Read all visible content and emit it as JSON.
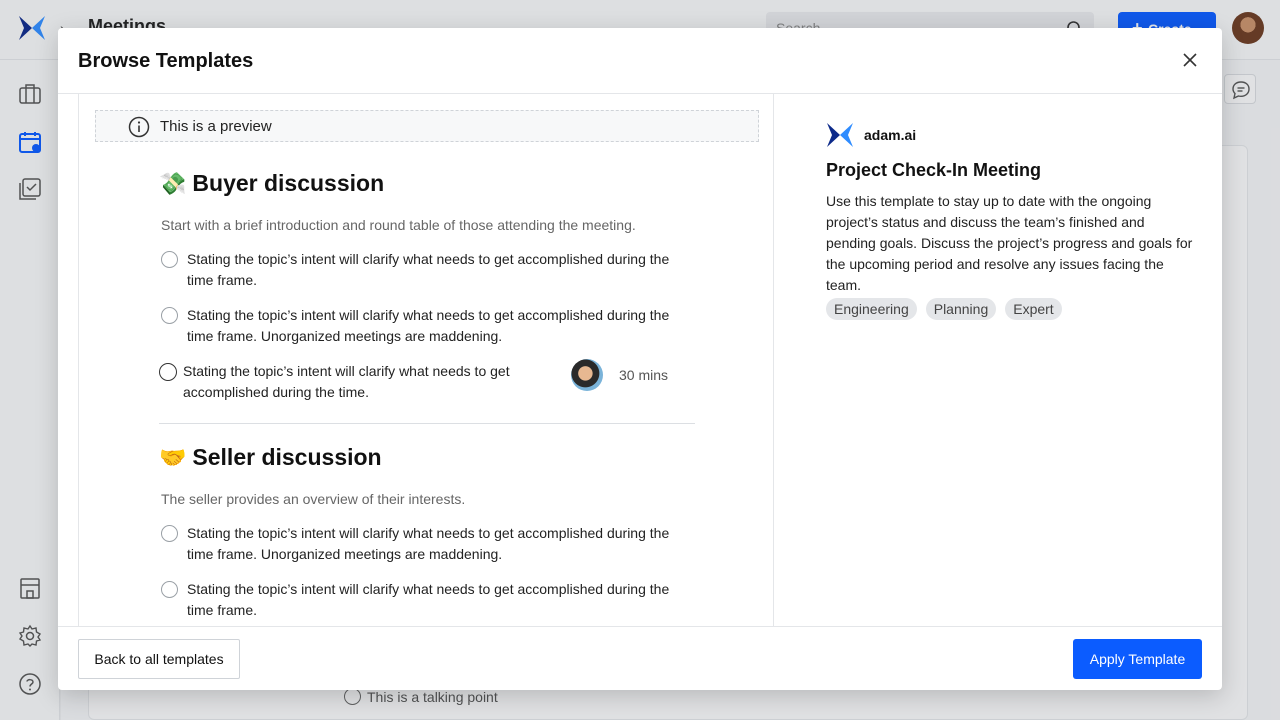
{
  "app": {
    "title": "Meetings",
    "search_placeholder": "Search",
    "create_label": "Create",
    "background_talking_point": "This is a talking point"
  },
  "modal": {
    "title": "Browse Templates",
    "preview_banner": "This is a preview",
    "sections": [
      {
        "emoji": "💸",
        "title": "Buyer discussion",
        "description": "Start with a brief introduction and round table of those attending the meeting.",
        "points": [
          "Stating the topic’s intent will clarify what needs to get accomplished during the time frame.",
          "Stating the topic’s intent will clarify what needs to get accomplished during the time frame. Unorganized meetings are maddening.",
          "Stating the topic’s intent will clarify what needs to get accomplished during the time."
        ],
        "point_duration": "30 mins"
      },
      {
        "emoji": "🤝",
        "title": "Seller discussion",
        "description": "The seller provides an overview of their interests.",
        "points": [
          "Stating the topic’s intent will clarify what needs to get accomplished during the time frame. Unorganized meetings are maddening.",
          "Stating the topic’s intent will clarify what needs to get accomplished during the time frame."
        ]
      }
    ],
    "info": {
      "brand": "adam.ai",
      "template_title": "Project Check-In Meeting",
      "template_description": "Use this template to stay up to date with the ongoing project’s status and discuss the team’s finished and pending goals. Discuss the project’s progress and goals for the upcoming period and resolve any issues facing the team.",
      "tags": [
        "Engineering",
        "Planning",
        "Expert"
      ]
    },
    "footer": {
      "back_label": "Back to all templates",
      "apply_label": "Apply Template"
    }
  },
  "colors": {
    "accent": "#0b5cff",
    "brand_dark": "#0d2a8a",
    "brand_light": "#2f8cff"
  }
}
